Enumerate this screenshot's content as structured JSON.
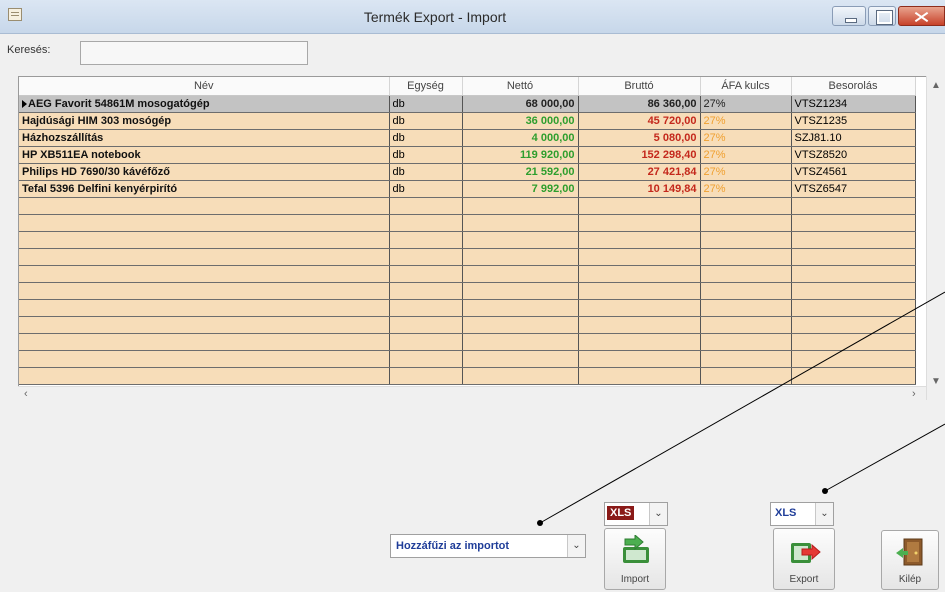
{
  "window": {
    "title": "Termék Export - Import"
  },
  "search": {
    "label": "Keresés:",
    "value": ""
  },
  "grid": {
    "columns": [
      "Név",
      "Egység",
      "Nettó",
      "Bruttó",
      "ÁFA kulcs",
      "Besorolás"
    ],
    "rows": [
      {
        "nev": "AEG Favorit 54861M mosogatógép",
        "egyseg": "db",
        "netto": "68 000,00",
        "brutto": "86 360,00",
        "afa": "27%",
        "besorolas": "VTSZ1234"
      },
      {
        "nev": "Hajdúsági HIM 303 mosógép",
        "egyseg": "db",
        "netto": "36 000,00",
        "brutto": "45 720,00",
        "afa": "27%",
        "besorolas": "VTSZ1235"
      },
      {
        "nev": "Házhozszállítás",
        "egyseg": "db",
        "netto": "4 000,00",
        "brutto": "5 080,00",
        "afa": "27%",
        "besorolas": "SZJ81.10"
      },
      {
        "nev": "HP XB511EA notebook",
        "egyseg": "db",
        "netto": "119 920,00",
        "brutto": "152 298,40",
        "afa": "27%",
        "besorolas": "VTSZ8520"
      },
      {
        "nev": "Philips HD 7690/30 kávéfőző",
        "egyseg": "db",
        "netto": "21 592,00",
        "brutto": "27 421,84",
        "afa": "27%",
        "besorolas": "VTSZ4561"
      },
      {
        "nev": "Tefal 5396 Delfini kenyérpirító",
        "egyseg": "db",
        "netto": "7 992,00",
        "brutto": "10 149,84",
        "afa": "27%",
        "besorolas": "VTSZ6547"
      }
    ],
    "selected_row": 0
  },
  "controls": {
    "mode_select": "Hozzáfűzi az importot",
    "import_format": "XLS",
    "export_format": "XLS",
    "import_button": "Import",
    "export_button": "Export",
    "exit_button": "Kilép"
  }
}
